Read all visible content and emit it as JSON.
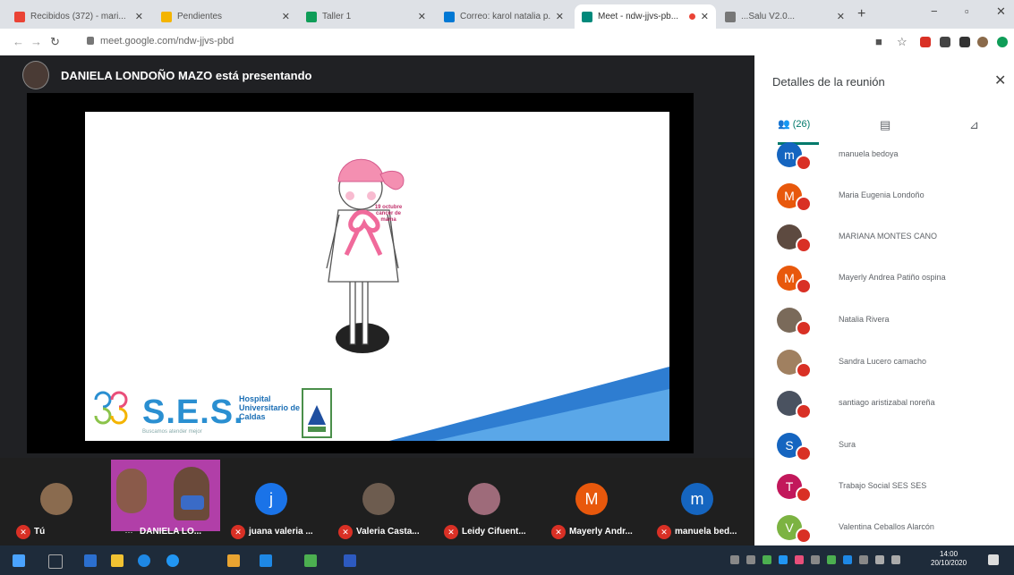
{
  "browser": {
    "tabs": [
      {
        "title": "Recibidos (372) - mari...",
        "icon_color": "#ea4335"
      },
      {
        "title": "Pendientes",
        "icon_color": "#f4b400"
      },
      {
        "title": "Taller 1",
        "icon_color": "#0f9d58"
      },
      {
        "title": "Correo: karol natalia p...",
        "icon_color": "#0078d4"
      },
      {
        "title": "Meet - ndw-jjvs-pb...",
        "icon_color": "#00897b"
      },
      {
        "title": "...Salu V2.0...",
        "icon_color": "#555555"
      }
    ],
    "new_tab": "+",
    "window_controls": [
      "−",
      "▫",
      "✕"
    ],
    "url": "meet.google.com/ndw-jjvs-pbd"
  },
  "meet": {
    "presenter_text": "DANIELA LONDOÑO MAZO está presentando",
    "slide": {
      "ribbon_text": "19 octubre cancer de mama",
      "logo": "S.E.S.",
      "hospital": "Hospital Universitario de Caldas",
      "slogan": "Buscamos atender mejor"
    },
    "participant_strip": [
      {
        "name": "Tú",
        "initial": "",
        "color": "#8a6b4f"
      },
      {
        "name": "DANIELA LO...",
        "initial": "",
        "color": "#b13fa8"
      },
      {
        "name": "juana valeria ...",
        "initial": "j",
        "color": "#1a73e8"
      },
      {
        "name": "Valeria Casta...",
        "initial": "",
        "color": "#6d5c4f"
      },
      {
        "name": "Leidy Cifuent...",
        "initial": "",
        "color": "#9e6b7a"
      },
      {
        "name": "Mayerly Andr...",
        "initial": "M",
        "color": "#e8580c"
      },
      {
        "name": "manuela bed...",
        "initial": "m",
        "color": "#1565c0"
      }
    ]
  },
  "panel": {
    "title": "Detalles de la reunión",
    "people_count": "(26)",
    "participants": [
      {
        "name": "manuela bedoya",
        "initial": "m",
        "color": "#1565c0"
      },
      {
        "name": "Maria Eugenia Londoño",
        "initial": "M",
        "color": "#e8580c"
      },
      {
        "name": "MARIANA MONTES CANO",
        "initial": "",
        "color": "#5d4a40"
      },
      {
        "name": "Mayerly Andrea Patiño ospina",
        "initial": "M",
        "color": "#e8580c"
      },
      {
        "name": "Natalia Rivera",
        "initial": "",
        "color": "#7a6a5a"
      },
      {
        "name": "Sandra Lucero camacho",
        "initial": "",
        "color": "#a08060"
      },
      {
        "name": "santiago aristizabal noreña",
        "initial": "",
        "color": "#4a5260"
      },
      {
        "name": "Sura",
        "initial": "S",
        "color": "#1565c0"
      },
      {
        "name": "Trabajo Social SES SES",
        "initial": "T",
        "color": "#c2185b"
      },
      {
        "name": "Valentina Ceballos Alarcón",
        "initial": "V",
        "color": "#7cb342"
      }
    ]
  },
  "taskbar": {
    "time": "14:00",
    "date": "20/10/2020"
  }
}
